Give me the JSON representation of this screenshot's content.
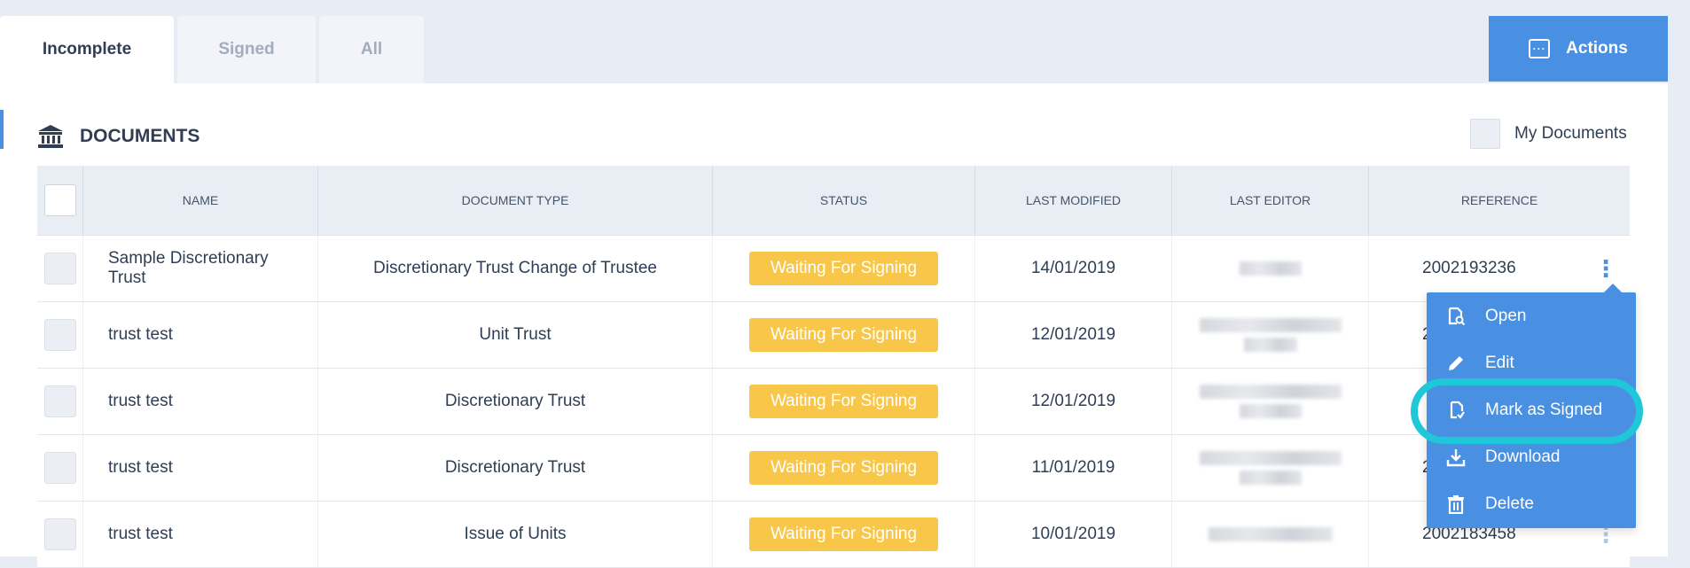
{
  "tabs": [
    {
      "label": "Incomplete",
      "active": true
    },
    {
      "label": "Signed",
      "active": false
    },
    {
      "label": "All",
      "active": false
    }
  ],
  "actions_button": {
    "label": "Actions",
    "icon": "more-horizontal-icon"
  },
  "section": {
    "title": "DOCUMENTS",
    "icon": "bank-icon"
  },
  "my_documents": {
    "label": "My Documents",
    "checked": false
  },
  "table": {
    "headers": [
      "NAME",
      "DOCUMENT TYPE",
      "STATUS",
      "LAST MODIFIED",
      "LAST EDITOR",
      "REFERENCE"
    ],
    "rows": [
      {
        "name": "Sample Discretionary Trust",
        "type": "Discretionary Trust Change of Trustee",
        "status": "Waiting For Signing",
        "modified": "14/01/2019",
        "reference": "2002193236"
      },
      {
        "name": "trust test",
        "type": "Unit Trust",
        "status": "Waiting For Signing",
        "modified": "12/01/2019",
        "reference": "2"
      },
      {
        "name": "trust test",
        "type": "Discretionary Trust",
        "status": "Waiting For Signing",
        "modified": "12/01/2019",
        "reference": ""
      },
      {
        "name": "trust test",
        "type": "Discretionary Trust",
        "status": "Waiting For Signing",
        "modified": "11/01/2019",
        "reference": "2"
      },
      {
        "name": "trust test",
        "type": "Issue of Units",
        "status": "Waiting For Signing",
        "modified": "10/01/2019",
        "reference": "2002183458"
      }
    ]
  },
  "context_menu": {
    "items": [
      {
        "label": "Open",
        "icon": "document-search-icon"
      },
      {
        "label": "Edit",
        "icon": "pencil-icon"
      },
      {
        "label": "Mark as Signed",
        "icon": "document-check-icon",
        "highlighted": true
      },
      {
        "label": "Download",
        "icon": "download-icon"
      },
      {
        "label": "Delete",
        "icon": "trash-icon"
      }
    ]
  },
  "colors": {
    "accent": "#4a90e2",
    "status_badge": "#f8c74a",
    "highlight_ring": "#1ec8d8",
    "background": "#e8ecf5"
  }
}
